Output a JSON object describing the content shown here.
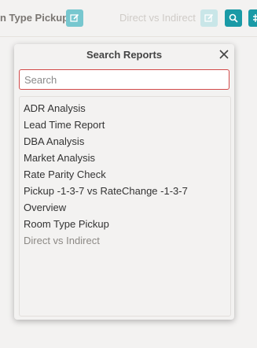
{
  "toolbar": {
    "tab_active_label": "n Type Pickup",
    "tab_faded_label": "Direct vs Indirect",
    "accent_color": "#1a9aa6"
  },
  "popup": {
    "title": "Search Reports",
    "search_placeholder": "Search",
    "search_value": "",
    "items": [
      {
        "label": "ADR Analysis",
        "dim": false
      },
      {
        "label": "Lead Time Report",
        "dim": false
      },
      {
        "label": "DBA Analysis",
        "dim": false
      },
      {
        "label": "Market Analysis",
        "dim": false
      },
      {
        "label": "Rate Parity Check",
        "dim": false
      },
      {
        "label": "Pickup -1-3-7 vs RateChange -1-3-7",
        "dim": false
      },
      {
        "label": "Overview",
        "dim": false
      },
      {
        "label": "Room Type Pickup",
        "dim": false
      },
      {
        "label": "Direct vs Indirect",
        "dim": true
      }
    ]
  }
}
